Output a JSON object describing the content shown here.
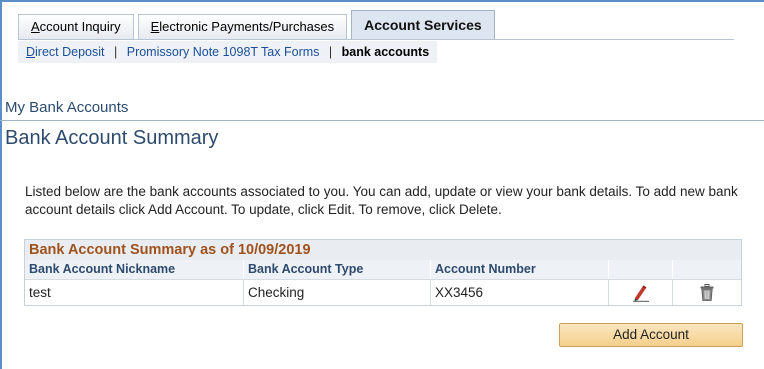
{
  "tabs": [
    {
      "label_u": "A",
      "label_rest": "ccount Inquiry"
    },
    {
      "label_u": "E",
      "label_rest": "lectronic Payments/Purchases"
    },
    {
      "label": "Account Services"
    }
  ],
  "subnav": {
    "direct_deposit_u": "D",
    "direct_deposit_rest": "irect Deposit",
    "sep": "|",
    "promissory": "Promissory Note 1098T Tax Forms",
    "current": "bank accounts"
  },
  "page": {
    "subtitle": "My Bank Accounts",
    "title": "Bank Account Summary",
    "description": "Listed below are the bank accounts associated to you. You can add, update or view your bank details. To add new bank account details click Add Account. To update, click Edit. To remove, click Delete."
  },
  "grid": {
    "title": "Bank Account Summary as of 10/09/2019",
    "headers": [
      "Bank Account Nickname",
      "Bank Account Type",
      "Account Number",
      "",
      ""
    ],
    "rows": [
      {
        "nickname": "test",
        "type": "Checking",
        "number": "XX3456"
      }
    ],
    "edit_icon": "pencil-edit-icon",
    "delete_icon": "trash-delete-icon"
  },
  "add_button": "Add Account",
  "colors": {
    "frame_border": "#5a8fc7",
    "heading": "#2d4b6e",
    "grid_title": "#a0521d",
    "button": "#f4cf8c"
  }
}
